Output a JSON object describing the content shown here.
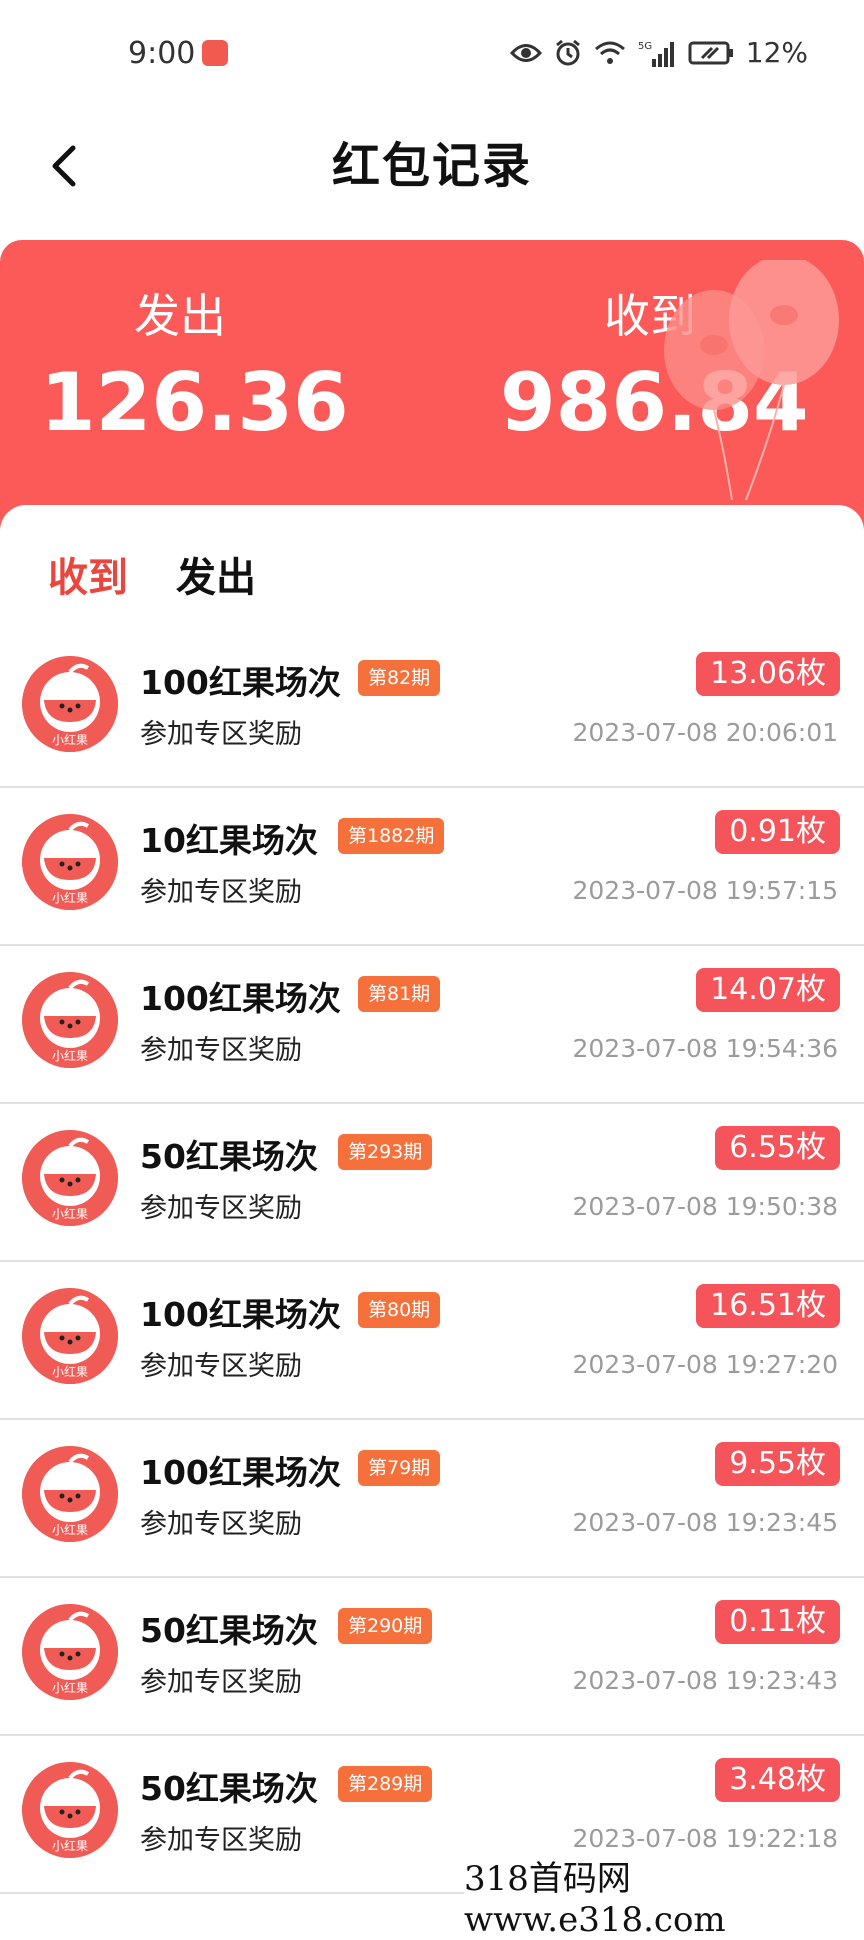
{
  "status": {
    "time": "9:00",
    "battery_text": "12%",
    "network": "5G"
  },
  "header": {
    "title": "红包记录"
  },
  "summary": {
    "sent_label": "发出",
    "sent_value": "126.36",
    "received_label": "收到",
    "received_value": "986.84"
  },
  "tabs": [
    {
      "label": "收到",
      "active": true
    },
    {
      "label": "发出",
      "active": false
    }
  ],
  "records": [
    {
      "title": "100红果场次",
      "badge": "第82期",
      "subtitle": "参加专区奖励",
      "amount": "13.06枚",
      "time": "2023-07-08 20:06:01"
    },
    {
      "title": "10红果场次",
      "badge": "第1882期",
      "subtitle": "参加专区奖励",
      "amount": "0.91枚",
      "time": "2023-07-08 19:57:15"
    },
    {
      "title": "100红果场次",
      "badge": "第81期",
      "subtitle": "参加专区奖励",
      "amount": "14.07枚",
      "time": "2023-07-08 19:54:36"
    },
    {
      "title": "50红果场次",
      "badge": "第293期",
      "subtitle": "参加专区奖励",
      "amount": "6.55枚",
      "time": "2023-07-08 19:50:38"
    },
    {
      "title": "100红果场次",
      "badge": "第80期",
      "subtitle": "参加专区奖励",
      "amount": "16.51枚",
      "time": "2023-07-08 19:27:20"
    },
    {
      "title": "100红果场次",
      "badge": "第79期",
      "subtitle": "参加专区奖励",
      "amount": "9.55枚",
      "time": "2023-07-08 19:23:45"
    },
    {
      "title": "50红果场次",
      "badge": "第290期",
      "subtitle": "参加专区奖励",
      "amount": "0.11枚",
      "time": "2023-07-08 19:23:43"
    },
    {
      "title": "50红果场次",
      "badge": "第289期",
      "subtitle": "参加专区奖励",
      "amount": "3.48枚",
      "time": "2023-07-08 19:22:18"
    }
  ],
  "avatar_caption": "小红果",
  "watermark": "318首码网  www.e318.com",
  "colors": {
    "accent": "#fb5a58",
    "badge": "#f5703a",
    "amount": "#f4545a",
    "tab_active": "#e8473f"
  }
}
